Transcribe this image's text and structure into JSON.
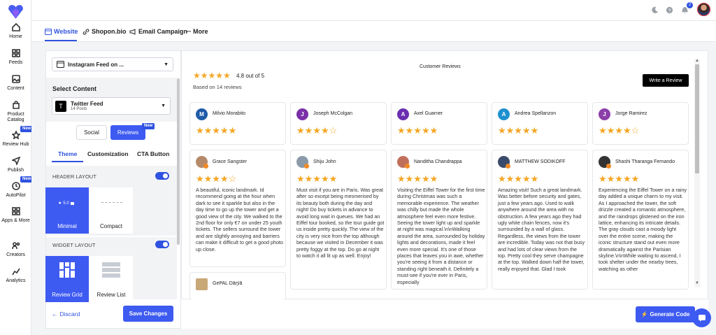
{
  "nav": {
    "items": [
      {
        "label": "Home",
        "icon": "home-icon"
      },
      {
        "label": "Feeds",
        "icon": "feeds-icon"
      },
      {
        "label": "Content",
        "icon": "content-icon"
      },
      {
        "label": "Product Catalog",
        "icon": "catalog-icon"
      },
      {
        "label": "Review Hub",
        "icon": "star-icon"
      },
      {
        "label": "Publish",
        "icon": "send-icon"
      },
      {
        "label": "AutoPilot",
        "icon": "autopilot-icon"
      },
      {
        "label": "Apps & More",
        "icon": "apps-icon"
      },
      {
        "label": "Creators",
        "icon": "creators-icon"
      },
      {
        "label": "Analytics",
        "icon": "analytics-icon"
      }
    ],
    "new_label": "New"
  },
  "topbar": {
    "notifications_count": "2"
  },
  "tabs": [
    {
      "label": "Website"
    },
    {
      "label": "Shopon.bio"
    },
    {
      "label": "Email Campaign"
    },
    {
      "label": "More"
    }
  ],
  "left": {
    "feed_select": "Instagram Feed on ...",
    "select_content_title": "Select Content",
    "source_name": "Twitter Feed",
    "source_posts": "14 Posts",
    "social_label": "Social",
    "reviews_label": "Reviews",
    "reviews_new": "New",
    "subtabs": [
      "Theme",
      "Customization",
      "CTA Button"
    ],
    "header_layout": "HEADER LAYOUT",
    "layout_minimal": "Minimal",
    "layout_compact": "Compact",
    "minimal_rating": "5.0",
    "widget_layout": "WIDGET LAYOUT",
    "widget_grid": "Review Grid",
    "widget_list": "Review List",
    "discard": "Discard",
    "save": "Save Changes"
  },
  "preview": {
    "title": "Customer Reviews",
    "rating_text": "4.8 out of 5",
    "based_on": "Based on 14 reviews",
    "write_review": "Write a Review",
    "generate_code": "Generate Code",
    "top_row": [
      {
        "name": "Milvio Morabito",
        "stars": 5,
        "color": "#1e5ba8",
        "initial": "M"
      },
      {
        "name": "Joseph McColgan",
        "stars": 4,
        "color": "#7b2fa8",
        "initial": "J"
      },
      {
        "name": "Axel Guarner",
        "stars": 5,
        "color": "#6a2fb0",
        "initial": "A"
      },
      {
        "name": "Andrea Spellanzon",
        "stars": 5,
        "color": "#1e90d0",
        "initial": "A"
      },
      {
        "name": "Jorge Ramirez",
        "stars": 4,
        "color": "#8b3fa8",
        "initial": "J"
      }
    ],
    "reviews": [
      {
        "name": "Grace Sangster",
        "stars": 4,
        "color": "#b58a6a",
        "text": "A beautiful, iconic landmark. Id recommend going at the hour when dark to see it sparkle but also in the day time to go up the tower and get a good view of the city. We walked to the 2nd floor for only €7 on under 25 youth tickets. The sellers surround the tower and are slightly annoying and barriers can make it difficult to get a good photo up close."
      },
      {
        "name": "Shiju John",
        "stars": 5,
        "color": "#8a9aa8",
        "text": "Must visit if you are in Paris. Was great after so except being mesmerised by its beauty both during the day and night! Do buy tickets in advance to avoid long wait in queues. We had an Eiffel tour booked, so the tour guide got us inside pretty quickly. The view of the city is very nice from the top although because we visited in December it was pretty foggy at the top. Do go at night to watch it all lit up as well. Enjoy!"
      },
      {
        "name": "Nanditha Chandrappa",
        "stars": 5,
        "color": "#c0705a",
        "text": "Visiting the Eiffel Tower for the first time during Christmas was such a memorable experience. The weather was chilly but made the whole atmosphere feel even more festive. Seeing the tower light up and sparkle at night was magical.\\n\\nWalking around the area, surrounded by holiday lights and decorations, made it feel even more special. It's one of those places that leaves you in awe, whether you're seeing it from a distance or standing right beneath it. Definitely a must-see if you're ever in Paris, especially"
      },
      {
        "name": "MATTHEW SODIKOFF",
        "stars": 5,
        "color": "#3a4a6a",
        "text": "Amazing visit! Such a great landmark. Was better before security and gates, just a few years ago. Used to walk anywhere around the area with no obstruction. A few years ago they had ugly white chain fences, now it's surrounded by a wall of glass. Regardless, the views from the tower are incredible. Today was not that busy and had lots of clear views from the top. Pretty cool they serve champagne at the top. Walked down half the tower, really enjoyed that. Glad I took"
      },
      {
        "name": "Shashi Tharanga Fernando",
        "stars": 5,
        "color": "#333333",
        "text": "Experiencing the Eiffel Tower on a rainy day added a unique charm to my visit. As I approached the tower, the soft drizzle created a romantic atmosphere, and the raindrops glistened on the iron lattice, enhancing its intricate details. The gray clouds cast a moody light over the entire scene, making the iconic structure stand out even more dramatically against the Parisian skyline.\\n\\nWhile waiting to ascend, I took shelter under the nearby trees, watching as other"
      }
    ],
    "bottom_partial": {
      "name": "GePAL Dāŗÿā",
      "color": "#c9a878"
    }
  }
}
